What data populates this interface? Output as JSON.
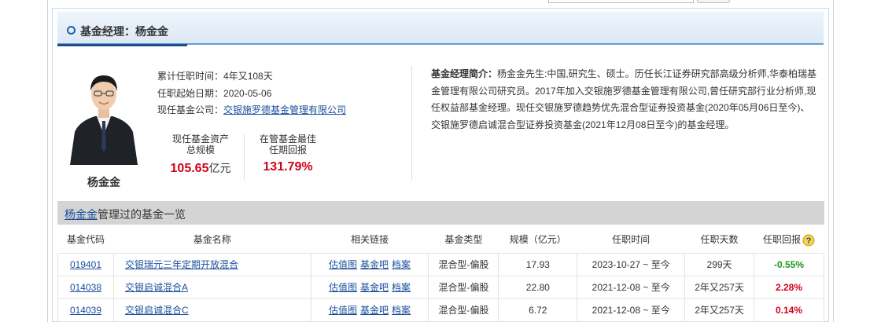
{
  "header": {
    "title": "基金经理：杨金金"
  },
  "manager": {
    "name": "杨金金",
    "tenure_label": "累计任职时间：",
    "tenure_value": "4年又108天",
    "start_label": "任职起始日期：",
    "start_value": "2020-05-06",
    "company_label": "现任基金公司：",
    "company_value": "交银施罗德基金管理有限公司",
    "assets_label_1": "现任基金资产",
    "assets_label_2": "总规模",
    "assets_value": "105.65",
    "assets_unit": "亿元",
    "best_label_1": "在管基金最佳",
    "best_label_2": "任期回报",
    "best_value": "131.79%"
  },
  "bio": {
    "label": "基金经理简介：",
    "text": "杨金金先生:中国,研究生、硕士。历任长江证券研究部高级分析师,华泰柏瑞基金管理有限公司研究员。2017年加入交银施罗德基金管理有限公司,曾任研究部行业分析师,现任权益部基金经理。现任交银施罗德趋势优先混合型证券投资基金(2020年05月06日至今)、交银施罗德启诚混合型证券投资基金(2021年12月08日至今)的基金经理。"
  },
  "fund_list": {
    "title_link": "杨金金",
    "title_suffix": "管理过的基金一览",
    "columns": [
      "基金代码",
      "基金名称",
      "相关链接",
      "基金类型",
      "规模（亿元）",
      "任职时间",
      "任职天数",
      "任职回报"
    ],
    "link_labels": [
      "估值图",
      "基金吧",
      "档案"
    ],
    "rows": [
      {
        "code": "019401",
        "name": "交银瑞元三年定期开放混合",
        "type": "混合型-偏股",
        "size": "17.93",
        "period": "2023-10-27 ~ 至今",
        "days": "299天",
        "return": "-0.55%"
      },
      {
        "code": "014038",
        "name": "交银启诚混合A",
        "type": "混合型-偏股",
        "size": "22.80",
        "period": "2021-12-08 ~ 至今",
        "days": "2年又257天",
        "return": "2.28%"
      },
      {
        "code": "014039",
        "name": "交银启诚混合C",
        "type": "混合型-偏股",
        "size": "6.72",
        "period": "2021-12-08 ~ 至今",
        "days": "2年又257天",
        "return": "0.14%"
      }
    ]
  },
  "colors": {
    "accent": "#1e5fa8",
    "positive": "#d0021b",
    "negative": "#1a9a1a"
  }
}
